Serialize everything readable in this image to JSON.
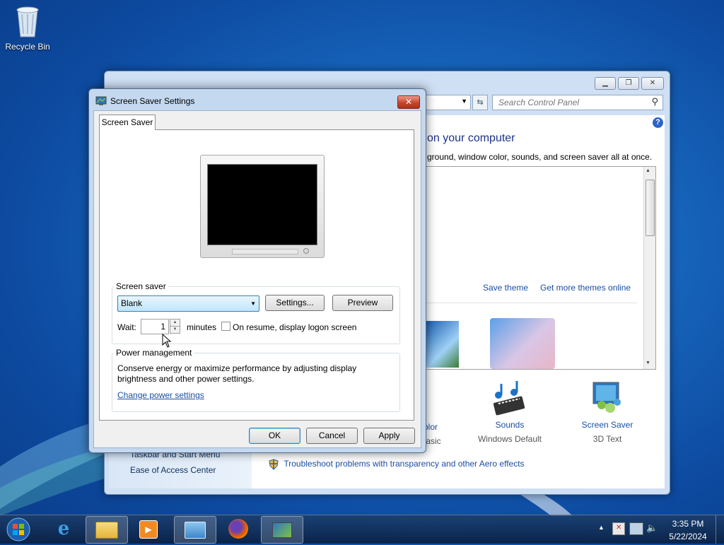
{
  "desktop": {
    "icons": [
      {
        "label": "Recycle Bin",
        "icon": "recycle-bin-icon"
      }
    ]
  },
  "control_panel": {
    "search_placeholder": "Search Control Panel",
    "heading": "on your computer",
    "subheading": "ground, window color, sounds, and screen saver all at once.",
    "save_theme": "Save theme",
    "more_themes": "Get more themes online",
    "left_links": [
      "Taskbar and Start Menu",
      "Ease of Access Center"
    ],
    "bottom_items": [
      {
        "name": "olor",
        "sub": "Basic"
      },
      {
        "name": "Sounds",
        "sub": "Windows Default"
      },
      {
        "name": "Screen Saver",
        "sub": "3D Text"
      }
    ],
    "troubleshoot": "Troubleshoot problems with transparency and other Aero effects"
  },
  "dialog": {
    "title": "Screen Saver Settings",
    "close_glyph": "✕",
    "tab": "Screen Saver",
    "screen_saver_group": "Screen saver",
    "selected_saver": "Blank",
    "settings_button": "Settings...",
    "preview_button": "Preview",
    "wait_label": "Wait:",
    "wait_value": "1",
    "minutes_label": "minutes",
    "resume_label": "On resume, display logon screen",
    "resume_checked": false,
    "power_group": "Power management",
    "power_text_1": "Conserve energy or maximize performance by adjusting display",
    "power_text_2": "brightness and other power settings.",
    "power_link": "Change power settings",
    "ok": "OK",
    "cancel": "Cancel",
    "apply": "Apply"
  },
  "taskbar": {
    "items": [
      "start-orb-icon",
      "internet-explorer-icon",
      "windows-explorer-icon",
      "media-player-icon",
      "control-panel-icon",
      "firefox-icon",
      "screen-saver-settings-icon"
    ],
    "time": "3:35 PM",
    "date": "5/22/2024"
  },
  "colors": {
    "link": "#1a4ea3",
    "close_button": "#c8452d",
    "desktop": "#1868bf"
  }
}
